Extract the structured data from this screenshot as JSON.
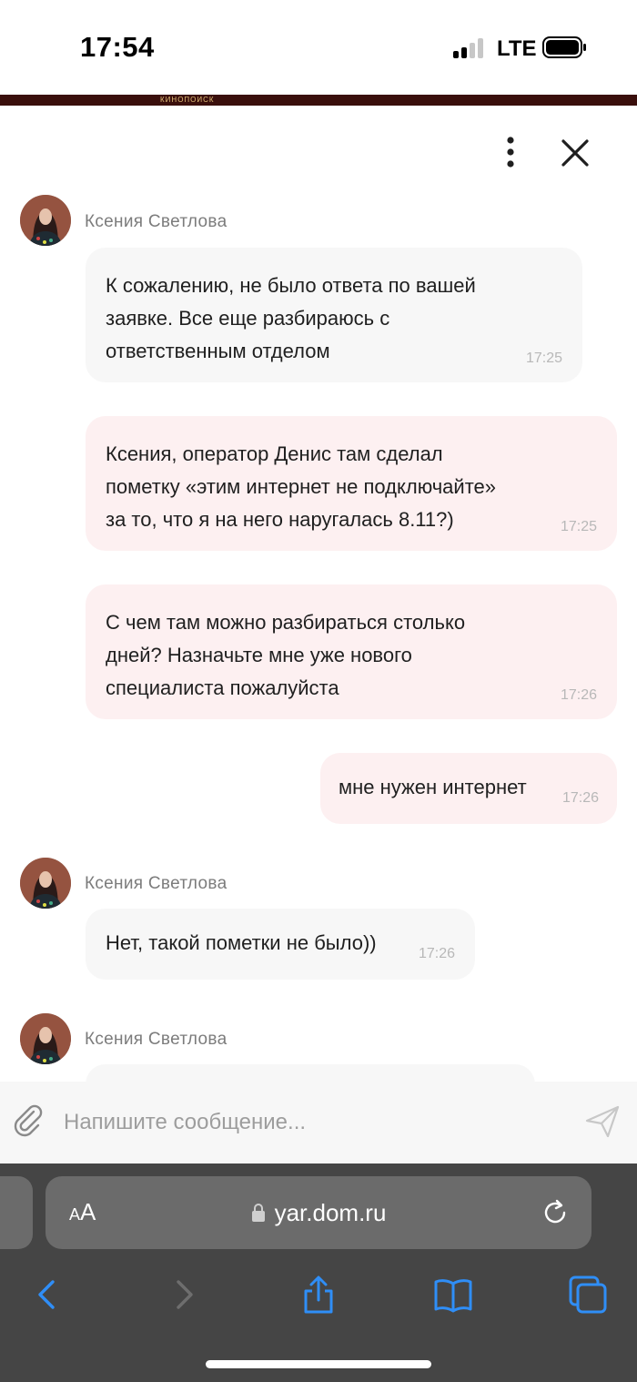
{
  "status_bar": {
    "time": "17:54",
    "network": "LTE"
  },
  "page_strip": {
    "text": "КИНОПОИСК"
  },
  "chat": {
    "messages": [
      {
        "direction": "in",
        "sender": "Ксения Светлова",
        "lines": [
          "К сожалению, не было ответа по вашей",
          "заявке. Все еще разбираюсь с",
          "ответственным отделом"
        ],
        "time": "17:25"
      },
      {
        "direction": "out",
        "lines": [
          "Ксения, оператор Денис там сделал",
          "пометку «этим интернет не подключайте»",
          "за то, что я на него наругалась 8.11?)"
        ],
        "time": "17:25"
      },
      {
        "direction": "out",
        "lines": [
          "С чем там можно разбираться столько",
          "дней? Назначьте мне уже нового",
          "специалиста пожалуйста"
        ],
        "time": "17:26"
      },
      {
        "direction": "out",
        "lines": [
          "мне нужен интернет"
        ],
        "time": "17:26"
      },
      {
        "direction": "in",
        "sender": "Ксения Светлова",
        "lines": [
          "Нет, такой пометки не было))"
        ],
        "time": "17:26"
      },
      {
        "direction": "in",
        "sender": "Ксения Светлова",
        "lines": [],
        "time": ""
      }
    ],
    "input": {
      "placeholder": "Напишите сообщение..."
    }
  },
  "browser": {
    "text_size_label_small": "A",
    "text_size_label_large": "A",
    "url": "yar.dom.ru"
  },
  "colors": {
    "incoming_bubble": "#f7f7f7",
    "outgoing_bubble": "#fdf0f1",
    "safari_chrome": "#454545",
    "accent_blue": "#2f8ef7"
  },
  "icons": {
    "more": "more-vertical-icon",
    "close": "close-icon",
    "attach": "paperclip-icon",
    "send": "send-icon",
    "lock": "lock-icon",
    "reload": "reload-icon",
    "back": "chevron-left-icon",
    "forward": "chevron-right-icon",
    "share": "share-icon",
    "bookmarks": "book-icon",
    "tabs": "tabs-icon"
  }
}
